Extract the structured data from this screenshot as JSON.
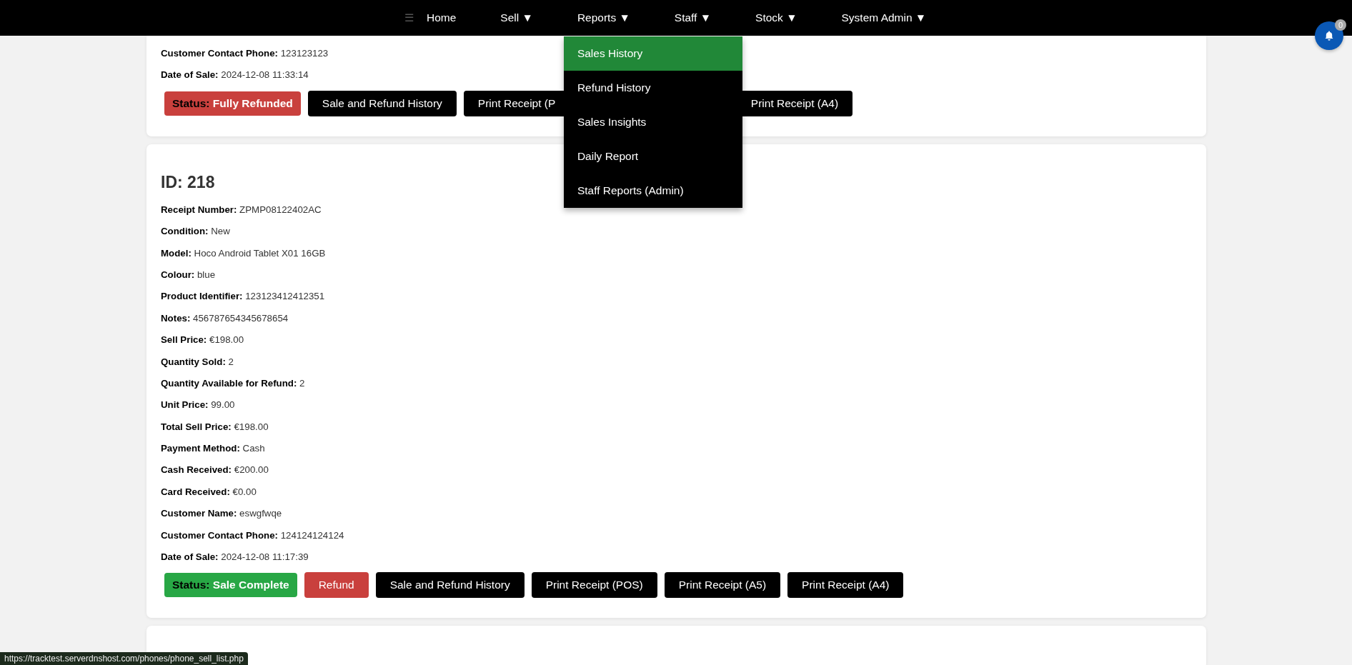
{
  "nav": {
    "menu_icon": "☰",
    "items": [
      {
        "label": "Home"
      },
      {
        "label": "Sell",
        "caret": "▼"
      },
      {
        "label": "Reports",
        "caret": "▼",
        "menu": [
          {
            "label": "Sales History",
            "selected": true
          },
          {
            "label": "Refund History",
            "selected": false
          },
          {
            "label": "Sales Insights",
            "selected": false
          },
          {
            "label": "Daily Report",
            "selected": false
          },
          {
            "label": "Staff Reports (Admin)",
            "selected": false
          }
        ]
      },
      {
        "label": "Staff",
        "caret": "▼"
      },
      {
        "label": "Stock",
        "caret": "▼"
      },
      {
        "label": "System Admin",
        "caret": "▼"
      }
    ]
  },
  "notifications": {
    "count": "0"
  },
  "cards": [
    {
      "rows": [
        {
          "label": "Customer Contact Phone:",
          "value": "123123123"
        },
        {
          "label": "Date of Sale:",
          "value": "2024-12-08 11:33:14"
        }
      ],
      "status": {
        "label": "Status:",
        "value": "Fully Refunded",
        "kind": "refunded"
      },
      "buttons": [
        {
          "label": "Sale and Refund History",
          "kind": "action",
          "covered": false
        },
        {
          "label": "Print Receipt (P",
          "kind": "action",
          "covered": true
        },
        {
          "label": "Print Receipt (A4)",
          "kind": "action",
          "covered": false
        }
      ]
    },
    {
      "title": "ID: 218",
      "rows": [
        {
          "label": "Receipt Number:",
          "value": "ZPMP08122402AC"
        },
        {
          "label": "Condition:",
          "value": "New"
        },
        {
          "label": "Model:",
          "value": "Hoco Android Tablet X01 16GB"
        },
        {
          "label": "Colour:",
          "value": "blue"
        },
        {
          "label": "Product Identifier:",
          "value": "123123412412351"
        },
        {
          "label": "Notes:",
          "value": "456787654345678654"
        },
        {
          "label": "Sell Price:",
          "value": "€198.00"
        },
        {
          "label": "Quantity Sold:",
          "value": "2"
        },
        {
          "label": "Quantity Available for Refund:",
          "value": "2"
        },
        {
          "label": "Unit Price:",
          "value": "99.00"
        },
        {
          "label": "Total Sell Price:",
          "value": "€198.00"
        },
        {
          "label": "Payment Method:",
          "value": "Cash"
        },
        {
          "label": "Cash Received:",
          "value": "€200.00"
        },
        {
          "label": "Card Received:",
          "value": "€0.00"
        },
        {
          "label": "Customer Name:",
          "value": "eswgfwqe"
        },
        {
          "label": "Customer Contact Phone:",
          "value": "124124124124"
        },
        {
          "label": "Date of Sale:",
          "value": "2024-12-08 11:17:39"
        }
      ],
      "status": {
        "label": "Status:",
        "value": "Sale Complete",
        "kind": "complete"
      },
      "buttons": [
        {
          "label": "Refund",
          "kind": "refund",
          "covered": false
        },
        {
          "label": "Sale and Refund History",
          "kind": "action",
          "covered": false
        },
        {
          "label": "Print Receipt (POS)",
          "kind": "action",
          "covered": false
        },
        {
          "label": "Print Receipt (A5)",
          "kind": "action",
          "covered": false
        },
        {
          "label": "Print Receipt (A4)",
          "kind": "action",
          "covered": false
        }
      ]
    }
  ],
  "link_preview": "https://tracktest.serverdnshost.com/phones/phone_sell_list.php"
}
